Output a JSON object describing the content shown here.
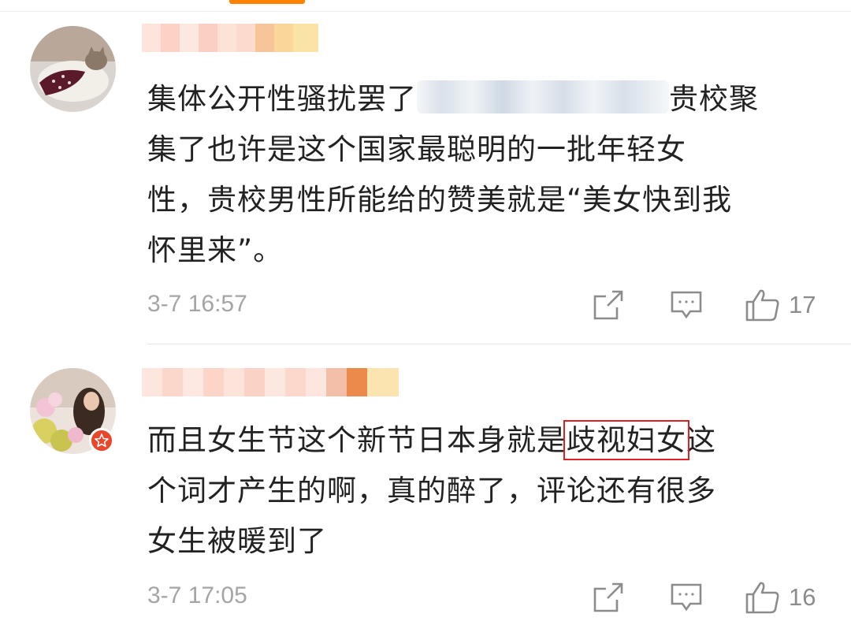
{
  "comments": [
    {
      "line1_pre": "集体公开性骚扰罢了",
      "line1_post": "贵校聚",
      "line2": "集了也许是这个国家最聪明的一批年轻女",
      "line3": "性，贵校男性所能给的赞美就是“美女快到我",
      "line4": "怀里来”。",
      "time": "3-7 16:57",
      "likes": "17"
    },
    {
      "line1_pre": "而且女生节这个新节日本身就是",
      "line1_highlight": "歧视妇女",
      "line1_post": "这",
      "line2": "个词才产生的啊，真的醉了，评论还有很多",
      "line3": "女生被暖到了",
      "time": "3-7 17:05",
      "likes": "16"
    }
  ],
  "icons": [
    "share-icon",
    "comment-icon",
    "like-icon"
  ],
  "colors": {
    "accent": "#ff8200",
    "highlight_box": "#e02020",
    "badge": "#e8472c"
  }
}
